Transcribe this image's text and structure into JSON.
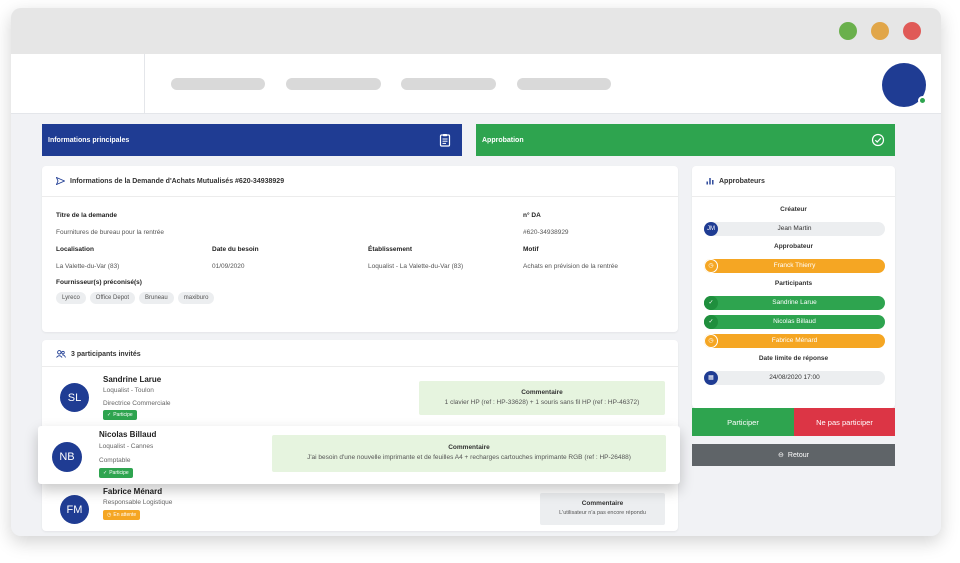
{
  "colors": {
    "navy": "#1f3c93",
    "green": "#2ea44f",
    "orange": "#f5a623",
    "red": "#dc3545",
    "gray_button": "#5f6468",
    "comment_green_bg": "#e6f4df",
    "comment_gray_bg": "#eceef0"
  },
  "window": {
    "traffic_lights": [
      "#6ab04c",
      "#e1a649",
      "#e05a57"
    ]
  },
  "tabs": {
    "main_label": "Informations principales",
    "main_icon": "clipboard-icon",
    "approval_label": "Approbation",
    "approval_icon": "check-circle-icon"
  },
  "request": {
    "header": "Informations de la Demande d'Achats Mutualisés #620-34938929",
    "title_label": "Titre de la demande",
    "title_value": "Fournitures de bureau pour la rentrée",
    "number_label": "n° DA",
    "number_value": "#620-34938929",
    "location_label": "Localisation",
    "location_value": "La Valette-du-Var (83)",
    "date_label": "Date du besoin",
    "date_value": "01/09/2020",
    "establishment_label": "Établissement",
    "establishment_value": "Loqualist - La Valette-du-Var (83)",
    "reason_label": "Motif",
    "reason_value": "Achats en prévision de la rentrée",
    "suppliers_label": "Fournisseur(s) préconisé(s)",
    "suppliers": [
      "Lyreco",
      "Office Depot",
      "Bruneau",
      "maxiburo"
    ]
  },
  "participants_card": {
    "header": "3 participants invités",
    "participants": [
      {
        "initials": "SL",
        "name": "Sandrine Larue",
        "company": "Loqualist - Toulon",
        "role": "Directrice Commerciale",
        "status": "Participe",
        "comment_title": "Commentaire",
        "comment": "1 clavier HP (ref : HP-33628) + 1 souris sans fil HP (ref : HP-46372)"
      },
      {
        "initials": "NB",
        "name": "Nicolas Billaud",
        "company": "Loqualist - Cannes",
        "role": "Comptable",
        "status": "Participe",
        "comment_title": "Commentaire",
        "comment": "J'ai besoin d'une nouvelle imprimante et de feuilles A4 + recharges cartouches imprimante RGB (ref : HP-26488)"
      },
      {
        "initials": "FM",
        "name": "Fabrice Ménard",
        "role": "Responsable Logistique",
        "status": "En attente",
        "comment_title": "Commentaire",
        "comment": "L'utilisateur n'a pas encore répondu"
      }
    ]
  },
  "approvers": {
    "header": "Approbateurs",
    "creator_label": "Créateur",
    "creator": {
      "initials": "JM",
      "name": "Jean Martin"
    },
    "approver_label": "Approbateur",
    "approver": {
      "name": "Franck Thierry",
      "status": "pending"
    },
    "participants_label": "Participants",
    "participants": [
      {
        "name": "Sandrine Larue",
        "status": "accepted"
      },
      {
        "name": "Nicolas Billaud",
        "status": "accepted"
      },
      {
        "name": "Fabrice Ménard",
        "status": "pending"
      }
    ],
    "deadline_label": "Date limite de réponse",
    "deadline": "24/08/2020 17:00"
  },
  "actions": {
    "participate": "Participer",
    "decline": "Ne pas participer",
    "back": "Retour"
  }
}
